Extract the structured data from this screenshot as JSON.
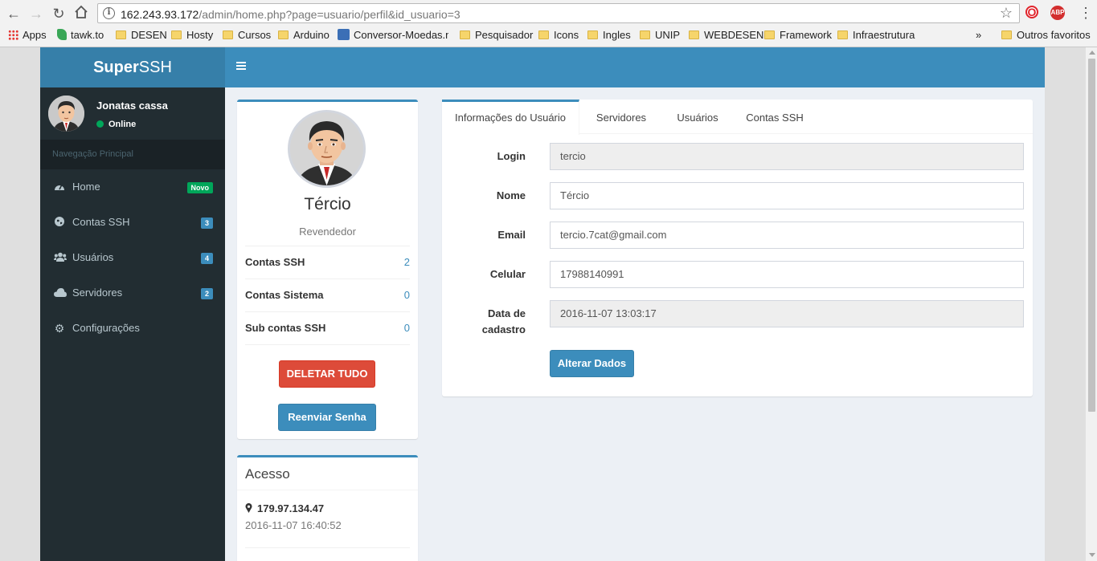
{
  "browser": {
    "url_host": "162.243.93.172",
    "url_path": "/admin/home.php?page=usuario/perfil&id_usuario=3",
    "ext_opera_label": "O",
    "ext_abp_label": "ABP",
    "bookmarks": [
      {
        "label": "Apps",
        "icon": "apps-grid-icon"
      },
      {
        "label": "tawk.to",
        "icon": "tawkto-icon"
      },
      {
        "label": "DESEN",
        "icon": "folder-icon"
      },
      {
        "label": "Hosty",
        "icon": "folder-icon"
      },
      {
        "label": "Cursos",
        "icon": "folder-icon"
      },
      {
        "label": "Arduino",
        "icon": "folder-icon"
      },
      {
        "label": "Conversor-Moedas.ne",
        "icon": "site-icon"
      },
      {
        "label": "Pesquisador",
        "icon": "folder-icon"
      },
      {
        "label": "Icons",
        "icon": "folder-icon"
      },
      {
        "label": "Ingles",
        "icon": "folder-icon"
      },
      {
        "label": "UNIP",
        "icon": "folder-icon"
      },
      {
        "label": "WEBDESEN",
        "icon": "folder-icon"
      },
      {
        "label": "Framework",
        "icon": "folder-icon"
      },
      {
        "label": "Infraestrutura",
        "icon": "folder-icon"
      }
    ],
    "overflow_label": "»",
    "other_bookmarks": "Outros favoritos"
  },
  "app": {
    "logo_bold": "Super",
    "logo_rest": "SSH",
    "accent": "#3c8dbc",
    "sidebar_bg": "#222d32"
  },
  "user_panel": {
    "name": "Jonatas cassa",
    "status": "Online"
  },
  "sidebar": {
    "header": "Navegação Principal",
    "items": [
      {
        "label": "Home",
        "icon": "dashboard-icon",
        "badge": "Novo"
      },
      {
        "label": "Contas SSH",
        "icon": "globe-icon",
        "badge": "3"
      },
      {
        "label": "Usuários",
        "icon": "users-icon",
        "badge": "4"
      },
      {
        "label": "Servidores",
        "icon": "cloud-icon",
        "badge": "2"
      },
      {
        "label": "Configurações",
        "icon": "gear-icon",
        "badge": ""
      }
    ]
  },
  "profile": {
    "name": "Tércio",
    "role": "Revendedor",
    "stats": [
      {
        "label": "Contas SSH",
        "value": "2"
      },
      {
        "label": "Contas Sistema",
        "value": "0"
      },
      {
        "label": "Sub contas SSH",
        "value": "0"
      }
    ],
    "delete_button": "DELETAR TUDO",
    "resend_button": "Reenviar Senha"
  },
  "access": {
    "title": "Acesso",
    "ip": "179.97.134.47",
    "date": "2016-11-07 16:40:52"
  },
  "tabs": [
    {
      "label": "Informações do Usuário",
      "active": true
    },
    {
      "label": "Servidores",
      "active": false
    },
    {
      "label": "Usuários",
      "active": false
    },
    {
      "label": "Contas SSH",
      "active": false
    }
  ],
  "form": {
    "login_label": "Login",
    "login_value": "tercio",
    "nome_label": "Nome",
    "nome_value": "Tércio",
    "email_label": "Email",
    "email_value": "tercio.7cat@gmail.com",
    "celular_label": "Celular",
    "celular_value": "17988140991",
    "data_label_line1": "Data de",
    "data_label_line2": "cadastro",
    "data_value": "2016-11-07 13:03:17",
    "save_button": "Alterar Dados"
  }
}
